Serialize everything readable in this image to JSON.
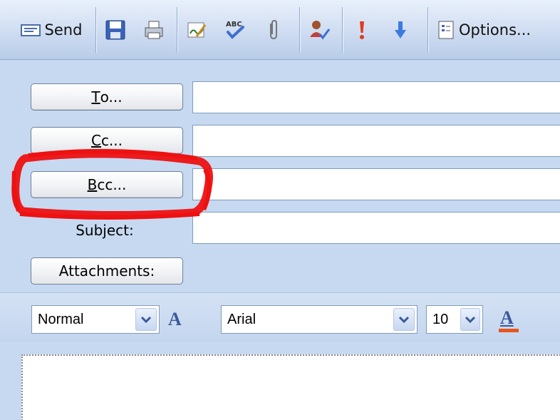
{
  "toolbar": {
    "send_label": "Send",
    "options_label": "Options..."
  },
  "addressing": {
    "to_label": "o...",
    "to_mnemonic": "T",
    "cc_label": "c...",
    "cc_mnemonic": "C",
    "bcc_label": "cc...",
    "bcc_mnemonic": "B",
    "to_value": "",
    "cc_value": "",
    "bcc_value": "",
    "subject_label": "Subject:",
    "subject_value": "",
    "attachments_label": "Attachments:"
  },
  "format": {
    "style_value": "Normal",
    "font_value": "Arial",
    "size_value": "10"
  },
  "colors": {
    "highlight": "#ee1111",
    "font_color_bar": "#e8551c",
    "header_bg": "#c6d9f1"
  }
}
